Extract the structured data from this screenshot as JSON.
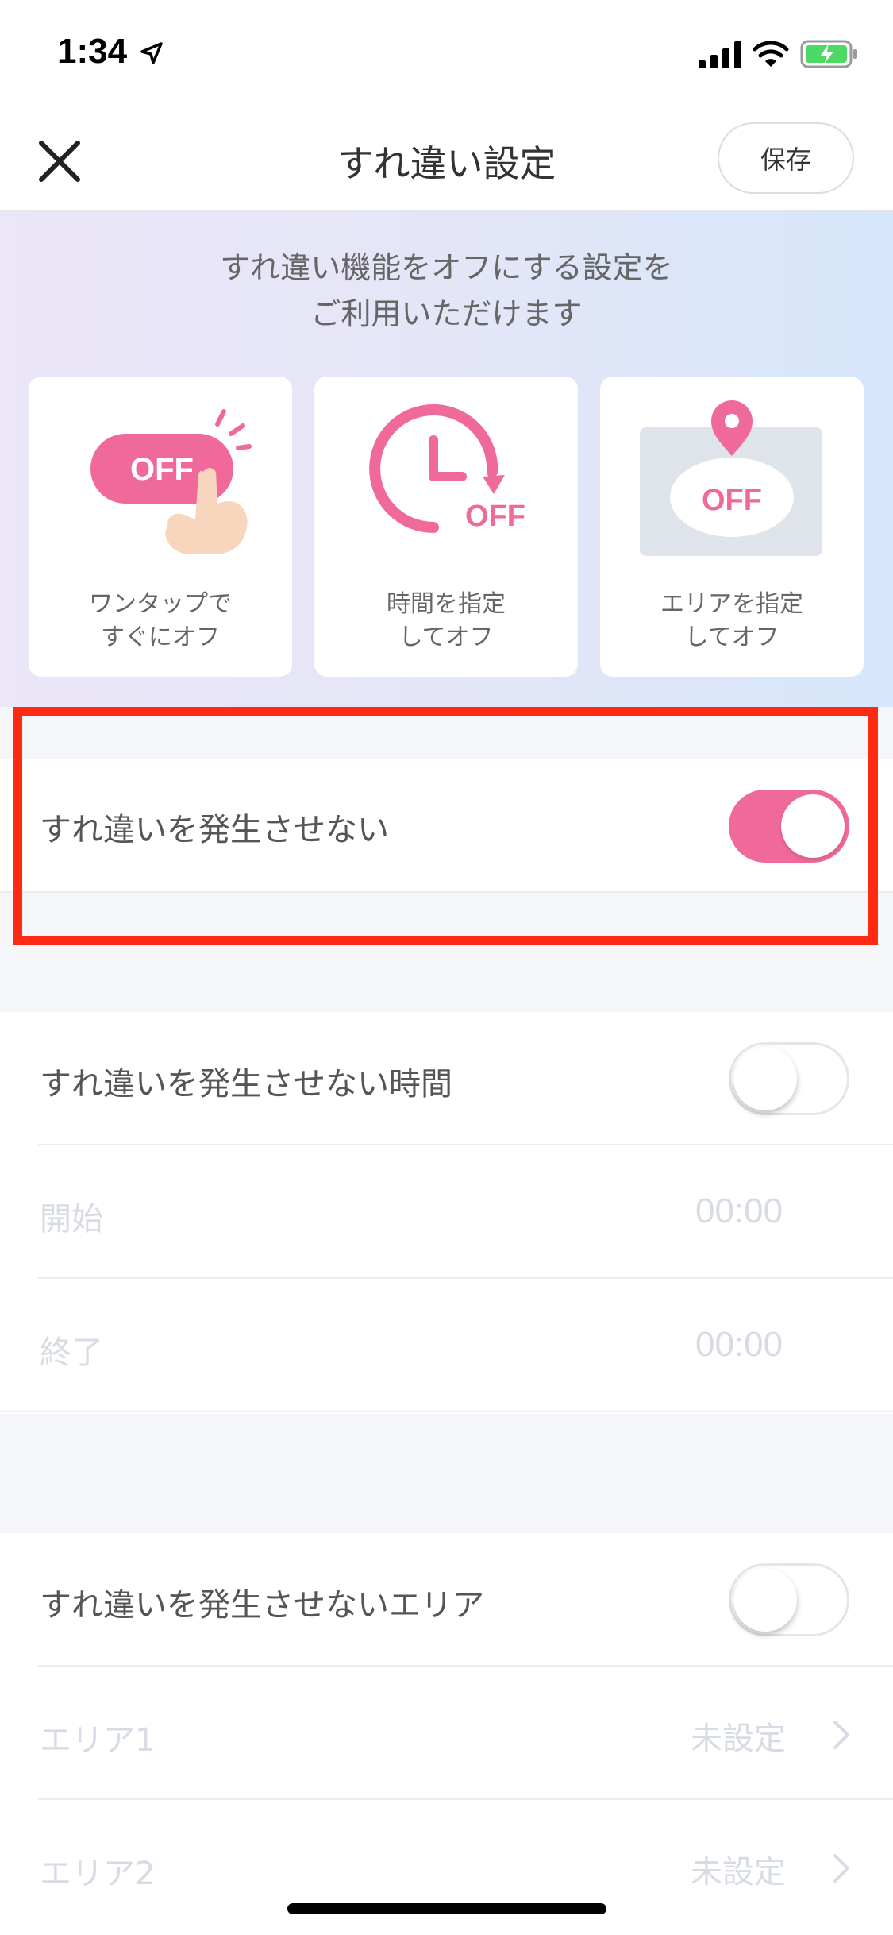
{
  "status_bar": {
    "time": "1:34",
    "icons": [
      "location-arrow-icon",
      "cellular-signal-icon",
      "wifi-icon",
      "battery-charging-icon"
    ]
  },
  "nav": {
    "title": "すれ違い設定",
    "save_label": "保存",
    "close_icon": "close-icon"
  },
  "banner": {
    "line1": "すれ違い機能をオフにする設定を",
    "line2": "ご利用いただけます",
    "cards": [
      {
        "art_text": "OFF",
        "caption_line1": "ワンタップで",
        "caption_line2": "すぐにオフ",
        "icon": "tap-off-icon"
      },
      {
        "art_text": "OFF",
        "caption_line1": "時間を指定",
        "caption_line2": "してオフ",
        "icon": "clock-off-icon"
      },
      {
        "art_text": "OFF",
        "caption_line1": "エリアを指定",
        "caption_line2": "してオフ",
        "icon": "map-pin-off-icon"
      }
    ]
  },
  "settings": {
    "disable_all": {
      "label": "すれ違いを発生させない",
      "enabled": true
    },
    "disable_time": {
      "label": "すれ違いを発生させない時間",
      "enabled": false,
      "start_label": "開始",
      "start_value": "00:00",
      "end_label": "終了",
      "end_value": "00:00"
    },
    "disable_area": {
      "label": "すれ違いを発生させないエリア",
      "enabled": false,
      "areas": [
        {
          "label": "エリア1",
          "value": "未設定"
        },
        {
          "label": "エリア2",
          "value": "未設定"
        }
      ]
    }
  },
  "colors": {
    "accent": "#f0699b",
    "highlight": "#ff2a12",
    "disabled_text": "#d7dbe3"
  }
}
